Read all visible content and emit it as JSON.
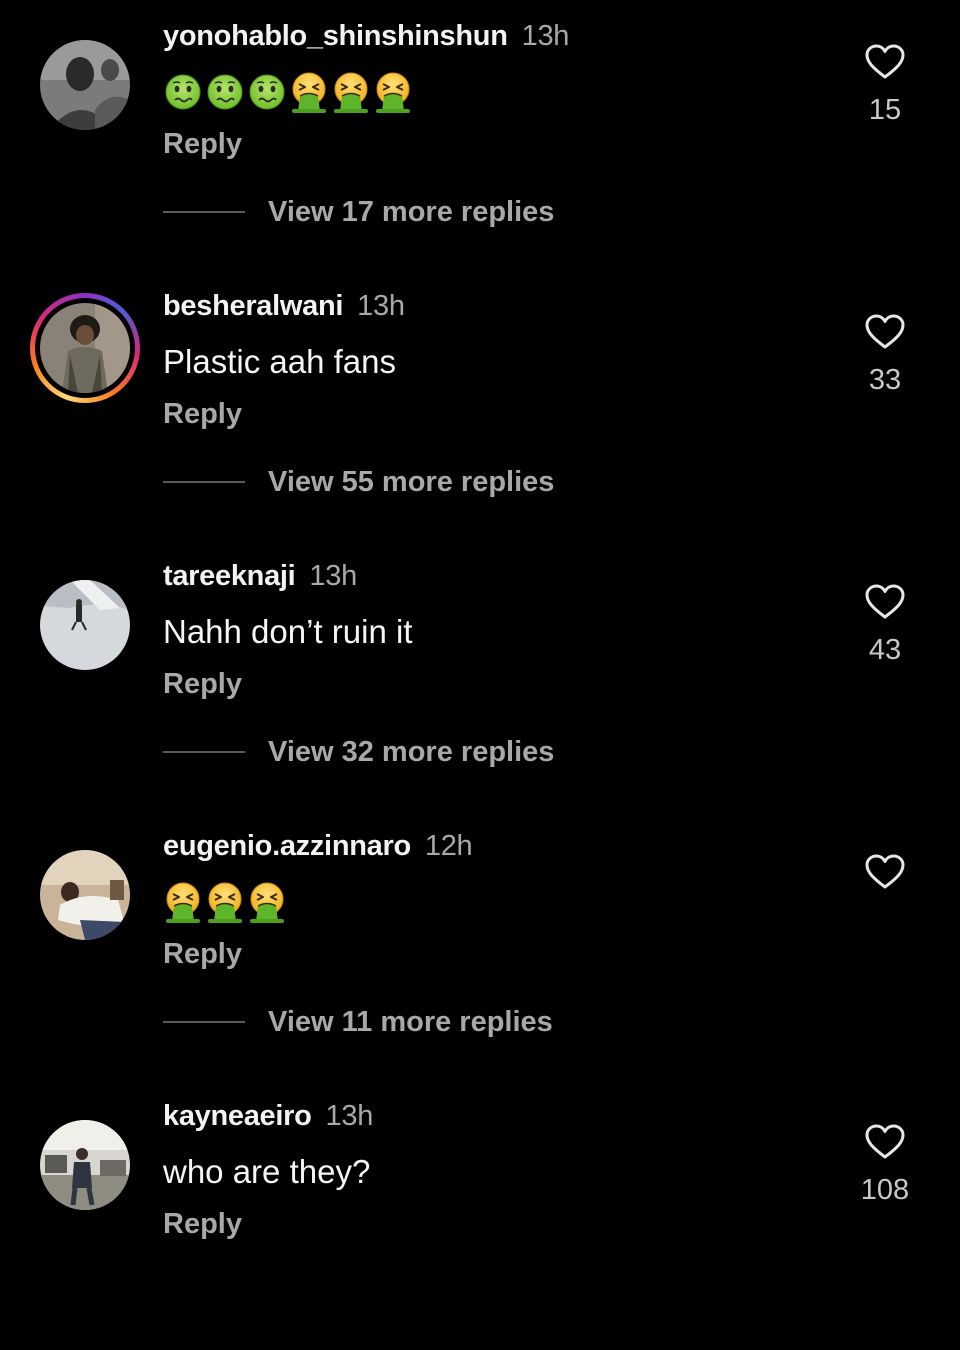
{
  "comments": [
    {
      "username": "yonohablo_shinshinshun",
      "time": "13h",
      "text": "",
      "emojis": [
        "nauseated-face",
        "nauseated-face",
        "nauseated-face",
        "vomiting-face",
        "vomiting-face",
        "vomiting-face"
      ],
      "reply_label": "Reply",
      "likes": "15",
      "view_replies": "View 17 more replies"
    },
    {
      "username": "besheralwani",
      "time": "13h",
      "text": "Plastic aah fans",
      "reply_label": "Reply",
      "likes": "33",
      "view_replies": "View 55 more replies"
    },
    {
      "username": "tareeknaji",
      "time": "13h",
      "text": "Nahh don’t ruin it",
      "reply_label": "Reply",
      "likes": "43",
      "view_replies": "View 32 more replies"
    },
    {
      "username": "eugenio.azzinnaro",
      "time": "12h",
      "text": "",
      "emojis": [
        "vomiting-face",
        "vomiting-face",
        "vomiting-face"
      ],
      "reply_label": "Reply",
      "likes": "",
      "view_replies": "View 11 more replies"
    },
    {
      "username": "kayneaeiro",
      "time": "13h",
      "text": "who are they?",
      "reply_label": "Reply",
      "likes": "108"
    }
  ],
  "icons": {
    "like": "heart-outline-icon"
  },
  "colors": {
    "background": "#000000",
    "text": "#f5f5f5",
    "secondary": "#a8a8a8"
  }
}
